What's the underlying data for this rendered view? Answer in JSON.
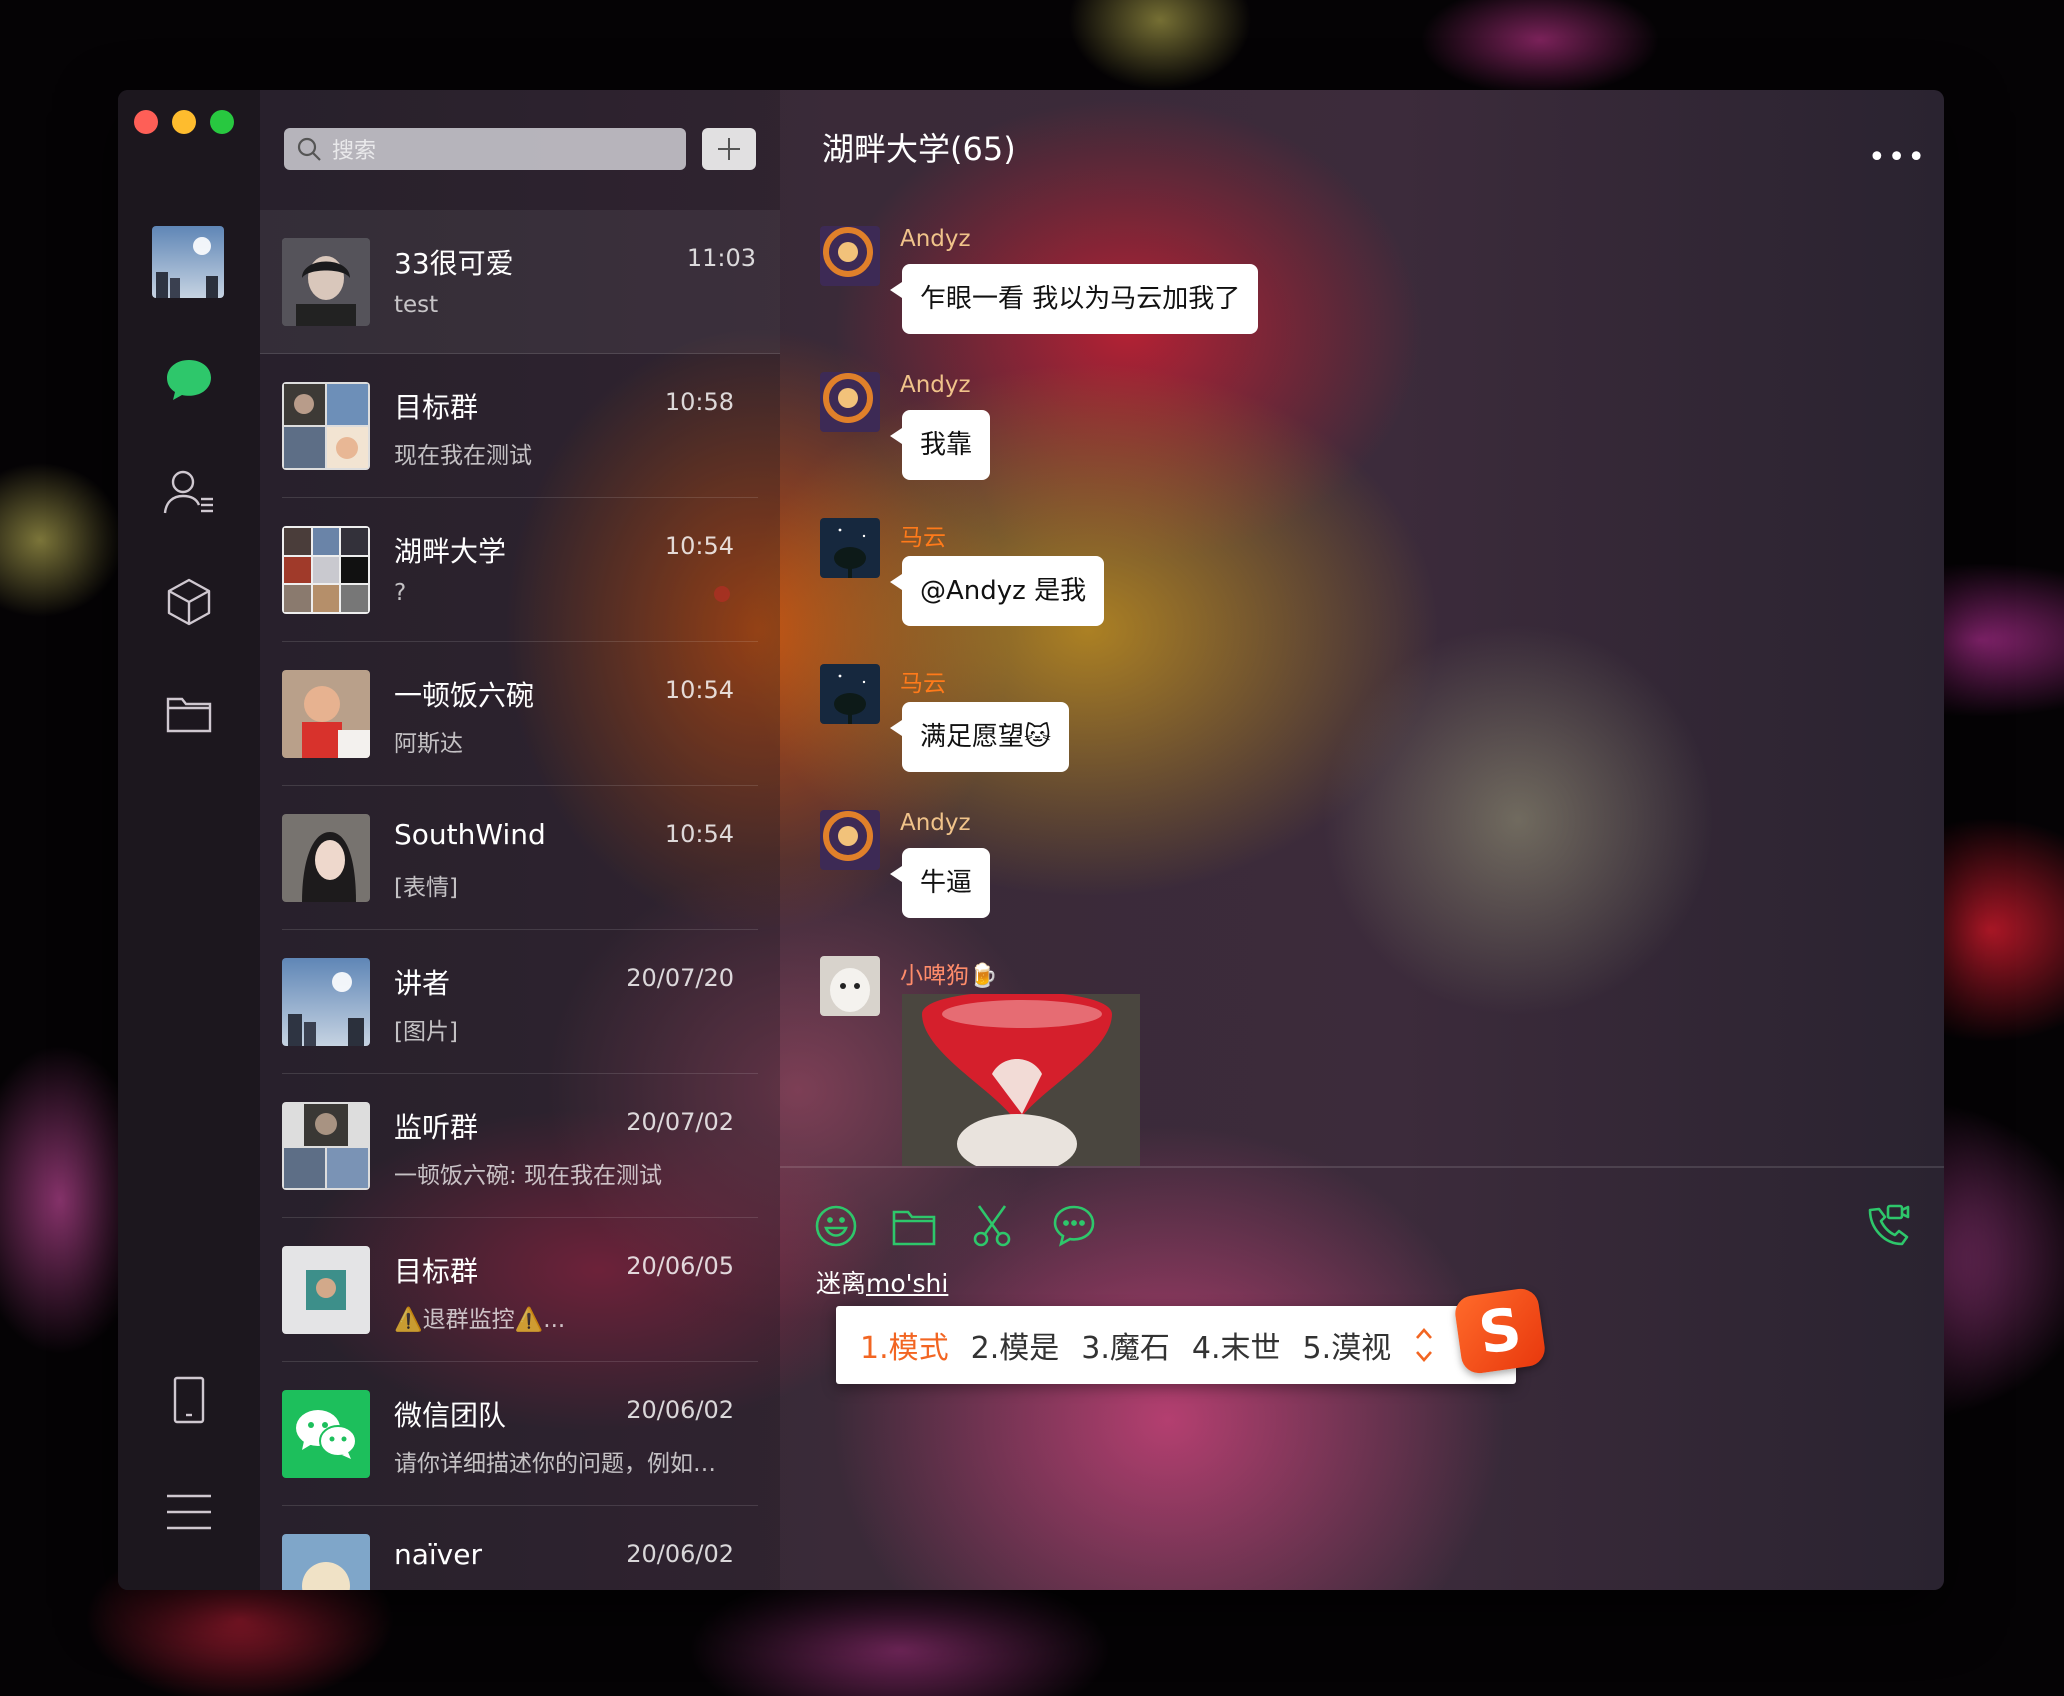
{
  "search": {
    "placeholder": "搜索",
    "icon": "search-icon"
  },
  "add_button": {
    "icon": "plus-icon"
  },
  "sidebar": {
    "items": [
      {
        "name": "profile-avatar"
      },
      {
        "name": "chats",
        "icon": "chat-bubble-icon",
        "active": true
      },
      {
        "name": "contacts",
        "icon": "contacts-icon"
      },
      {
        "name": "mini-programs",
        "icon": "cube-icon"
      },
      {
        "name": "files",
        "icon": "folder-icon"
      },
      {
        "name": "phone",
        "icon": "phone-icon"
      },
      {
        "name": "menu",
        "icon": "hamburger-menu-icon"
      }
    ]
  },
  "conversations": [
    {
      "name": "33很可爱",
      "time": "11:03",
      "preview": "test"
    },
    {
      "name": "目标群",
      "time": "10:58",
      "preview": "现在我在测试"
    },
    {
      "name": "湖畔大学",
      "time": "10:54",
      "preview": "?"
    },
    {
      "name": "一顿饭六碗",
      "time": "10:54",
      "preview": "阿斯达"
    },
    {
      "name": "SouthWind",
      "time": "10:54",
      "preview": "[表情]"
    },
    {
      "name": "讲者",
      "time": "20/07/20",
      "preview": "[图片]"
    },
    {
      "name": "监听群",
      "time": "20/07/02",
      "preview": "一顿饭六碗: 现在我在测试"
    },
    {
      "name": "目标群",
      "time": "20/06/05",
      "preview": "⚠️退群监控⚠️..."
    },
    {
      "name": "微信团队",
      "time": "20/06/02",
      "preview": "请你详细描述你的问题，例如…"
    },
    {
      "name": "naïver",
      "time": "20/06/02",
      "preview": ""
    }
  ],
  "chat": {
    "title": "湖畔大学(65)",
    "more_icon": "more-dots-icon",
    "messages": [
      {
        "sender": "Andyz",
        "text": "乍眼一看 我以为马云加我了",
        "sender_color": "#f0c38a"
      },
      {
        "sender": "Andyz",
        "text": "我靠",
        "sender_color": "#f0c38a"
      },
      {
        "sender": "马云",
        "text": "@Andyz 是我",
        "sender_color": "#ff7a1a"
      },
      {
        "sender": "马云",
        "text": "满足愿望🐱",
        "sender_color": "#ff7a1a"
      },
      {
        "sender": "Andyz",
        "text": "牛逼",
        "sender_color": "#f0c38a"
      },
      {
        "sender": "小啤狗🍺",
        "text": "",
        "sender_color": "#ff8c6a",
        "image": "heart-photo"
      }
    ]
  },
  "toolbar": {
    "icons": [
      "emoji-icon",
      "folder-icon",
      "scissors-icon",
      "chat-history-icon",
      "video-call-icon"
    ],
    "accent": "#2ec76b"
  },
  "compose": {
    "text_prefix": "迷离",
    "composing": "mo'shi"
  },
  "ime": {
    "candidates": [
      "1.模式",
      "2.模是",
      "3.魔石",
      "4.末世",
      "5.漠视"
    ],
    "logo": "S"
  }
}
